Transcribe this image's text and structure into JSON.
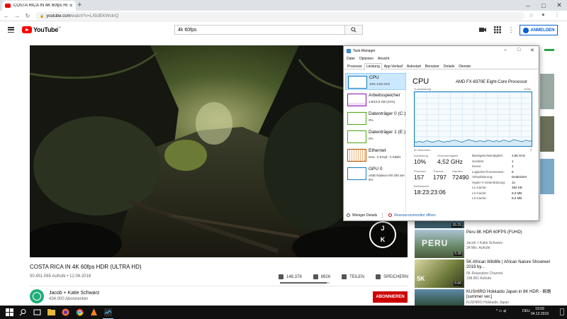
{
  "browser": {
    "tab_title": "COSTA RICA IN 4K 60fps HDR",
    "url_host": "youtube.com",
    "url_path": "/watch?v=LXb3EKWsInQ"
  },
  "youtube": {
    "logo_text": "YouTube",
    "region": "DE",
    "search_value": "4k 60fps",
    "signin_label": "ANMELDEN"
  },
  "video": {
    "title": "COSTA RICA IN 4K 60fps HDR (ULTRA HD)",
    "views_date": "50.451.065 Aufrufe • 12.06.2018",
    "likes": "148.378",
    "dislikes": "8926",
    "share_label": "TEILEN",
    "save_label": "SPEICHERN",
    "like_ratio": 0.94,
    "watermark_top": "J",
    "watermark_bottom": "K"
  },
  "channel": {
    "name": "Jacob + Katie Schwarz",
    "subscribers": "434.000 Abonnenten",
    "subscribe_label": "ABONNIEREN",
    "avatar_color": "#1fae79"
  },
  "sidebar": {
    "items": [
      {
        "duration": "5:38",
        "title": "Peru 8K HDR 60FPS (FUHD)",
        "channel": "Jacob + Katie Schwarz",
        "views": "34 Mio. Aufrufe",
        "thumb_label": "PERU"
      },
      {
        "duration": "6:06",
        "title": "5K African Wildlife | African Nature Showreel 2019 by...",
        "channel": "5K Relaxation Channel",
        "views": "198.861 Aufrufe",
        "thumb_label": "5K"
      },
      {
        "duration": "",
        "title": "KUSHIRO Hokkaido Japan in 8K HDR - 釧路 [summer ver.]",
        "channel": "KUSHIRO Hokkaido Japan",
        "views": "",
        "thumb_label": ""
      }
    ],
    "partial_duration": "05:25"
  },
  "taskmanager": {
    "title": "Task-Manager",
    "menu": [
      "Datei",
      "Optionen",
      "Ansicht"
    ],
    "tabs": [
      "Prozesse",
      "Leistung",
      "App-Verlauf",
      "Autostart",
      "Benutzer",
      "Details",
      "Dienste"
    ],
    "active_tab": "Leistung",
    "resources": [
      {
        "name": "CPU",
        "value": "10% 4,52 GHz",
        "color": "#117dbb"
      },
      {
        "name": "Arbeitsspeicher",
        "value": "3,8/15,9 GB (24%)",
        "color": "#8b12ae"
      },
      {
        "name": "Datenträger 0 (C:)",
        "value": "0%",
        "color": "#4da60c"
      },
      {
        "name": "Datenträger 1 (E:)",
        "value": "0%",
        "color": "#4da60c"
      },
      {
        "name": "Ethernet",
        "value": "Ges.: 0 Empf.: 0 KBit/s",
        "color": "#a74f01"
      },
      {
        "name": "GPU 0",
        "value": "AMD Radeon R9 200 Ser",
        "value2": "6%",
        "color": "#117dbb"
      }
    ],
    "cpu_heading": "CPU",
    "cpu_model": "AMD FX-8370E Eight-Core Processor",
    "axis_left_top": "% Auslastung",
    "axis_right_top": "100%",
    "axis_left_bottom": "60 Sekunden",
    "axis_right_bottom": "0",
    "stats": {
      "utilization_label": "Auslastung",
      "utilization": "10%",
      "speed_label": "Geschwindigkeit",
      "speed": "4,52 GHz",
      "processes_label": "Prozesse",
      "processes": "157",
      "threads_label": "Threads",
      "threads": "1797",
      "handles_label": "Handles",
      "handles": "72490",
      "uptime_label": "Betriebszeit",
      "uptime": "18:23:23:06"
    },
    "specs": [
      {
        "k": "Basisgeschwindigkeit:",
        "v": "4,56 GHz"
      },
      {
        "k": "Sockets:",
        "v": "1"
      },
      {
        "k": "Kerne:",
        "v": "4"
      },
      {
        "k": "Logische Prozessoren:",
        "v": "8"
      },
      {
        "k": "Virtualisierung:",
        "v": "Deaktiviert"
      },
      {
        "k": "Hyper-V-Unterstützung:",
        "v": "Ja"
      },
      {
        "k": "L1-Cache:",
        "v": "384 KB"
      },
      {
        "k": "L2-Cache:",
        "v": "8,0 MB"
      },
      {
        "k": "L3-Cache:",
        "v": "8,0 MB"
      }
    ],
    "fewer_details": "Weniger Details",
    "resource_monitor": "Ressourcenmonitor öffnen",
    "cpu_history_percent": [
      8,
      7,
      9,
      8,
      7,
      8,
      10,
      9,
      8,
      7,
      8,
      9,
      10,
      9,
      8,
      7,
      9,
      8,
      9,
      10,
      11,
      10,
      9,
      8,
      7,
      9,
      10,
      12,
      11,
      10,
      9,
      8,
      9,
      10,
      9,
      8,
      9,
      11,
      10,
      9,
      8,
      10,
      9,
      8,
      10,
      11,
      10,
      9,
      8,
      10,
      12,
      11,
      10,
      9,
      8,
      9,
      11,
      10,
      9,
      10
    ]
  },
  "taskbar": {
    "lang": "DEU",
    "time": "19:09",
    "date": "04.12.2019"
  }
}
